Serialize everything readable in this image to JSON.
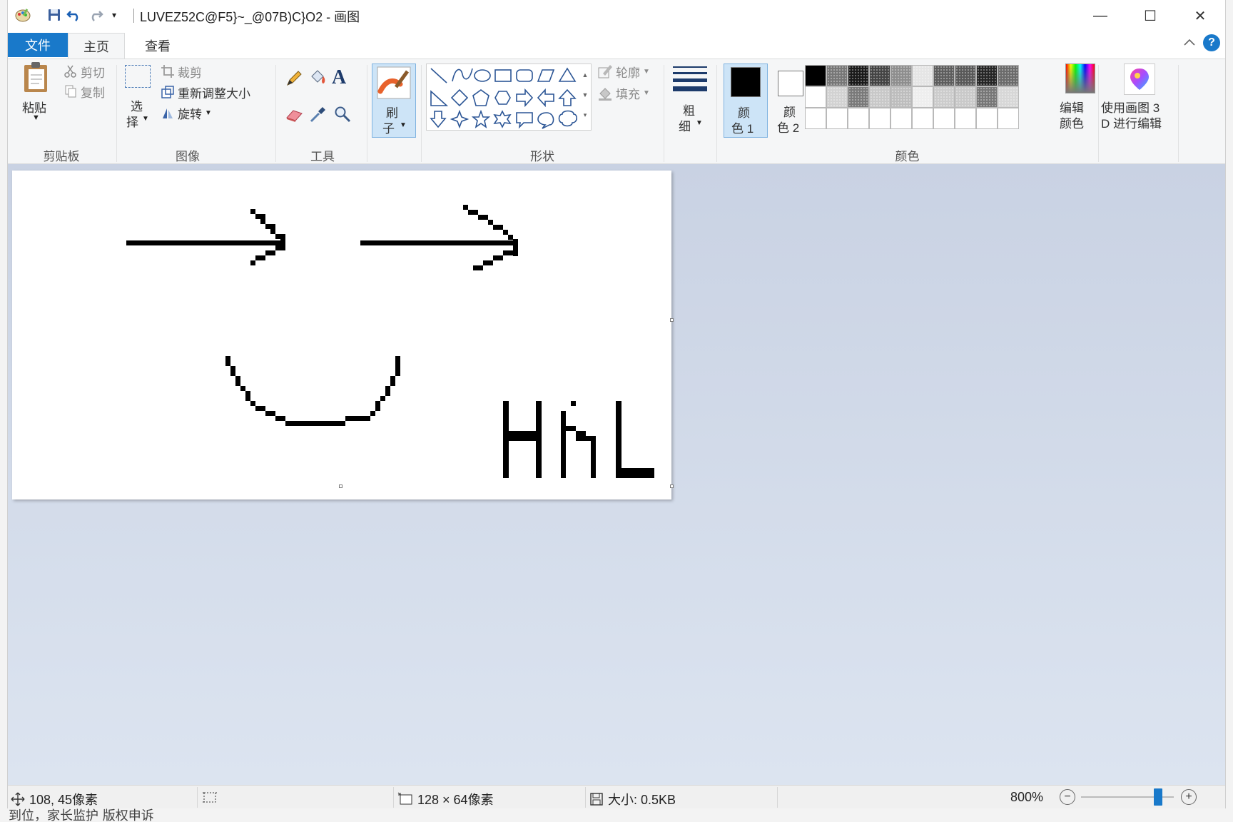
{
  "window": {
    "title": "LUVEZ52C@F5}~_@07B)C}O2 - 画图",
    "minimize": "—",
    "maximize": "☐",
    "close": "✕"
  },
  "quick_access": {
    "save_icon": "save-icon",
    "undo_icon": "undo-icon",
    "redo_icon": "redo-icon"
  },
  "tabs": {
    "file": "文件",
    "home": "主页",
    "view": "查看"
  },
  "ribbon": {
    "clipboard": {
      "paste": "粘贴",
      "cut": "剪切",
      "copy": "复制",
      "label": "剪贴板"
    },
    "image": {
      "select_1": "选",
      "select_2": "择",
      "crop": "裁剪",
      "resize": "重新调整大小",
      "rotate": "旋转",
      "label": "图像"
    },
    "tools": {
      "label": "工具"
    },
    "brush": {
      "line1": "刷",
      "line2": "子"
    },
    "shapes": {
      "outline": "轮廓",
      "fill": "填充",
      "label": "形状"
    },
    "size": {
      "line1": "粗",
      "line2": "细"
    },
    "colors": {
      "color1_a": "颜",
      "color1_b": "色 1",
      "color2_a": "颜",
      "color2_b": "色 2",
      "edit_a": "编辑",
      "edit_b": "颜色",
      "label": "颜色",
      "color1_value": "#000000",
      "color2_value": "#ffffff"
    },
    "paint3d": {
      "line1": "使用画图 3",
      "line2": "D 进行编辑"
    }
  },
  "status": {
    "cursor": "108, 45像素",
    "dimensions": "128 × 64像素",
    "size": "大小: 0.5KB",
    "zoom": "800%",
    "zoom_level": 0.83
  },
  "background_window": {
    "bottom_text": "到位，家长监护 版权申诉"
  }
}
